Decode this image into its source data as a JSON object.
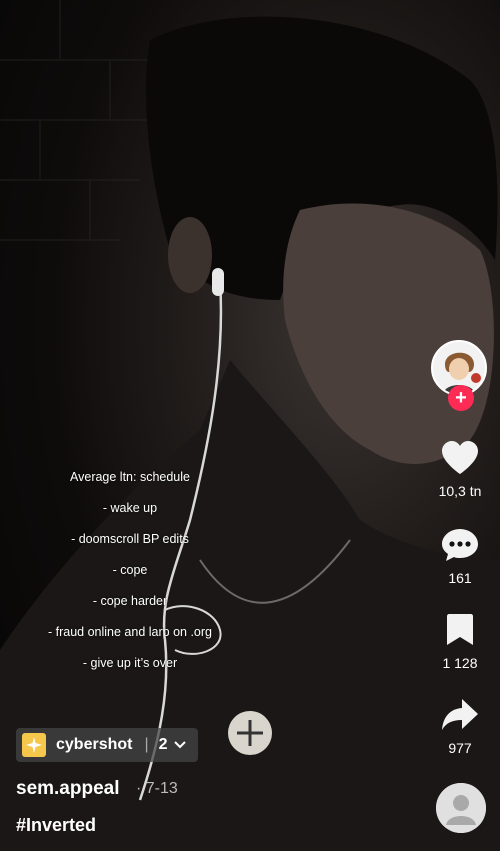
{
  "caption": {
    "lines": [
      "Average ltn: schedule",
      "- wake up",
      "- doomscroll BP edits",
      "- cope",
      "- cope harder",
      "- fraud online and larp on .org",
      "- give up it’s over"
    ]
  },
  "actions": {
    "likes": "10,3 tn",
    "comments": "161",
    "saves": "1 128",
    "shares": "977"
  },
  "author": {
    "username": "sem.appeal",
    "date": "· 7-13",
    "hashtag": "#Inverted"
  },
  "effect": {
    "name": "cybershot",
    "separator": "|",
    "count": "2"
  },
  "colors": {
    "accent": "#fe2c55",
    "effect_badge": "#f5c84b"
  }
}
